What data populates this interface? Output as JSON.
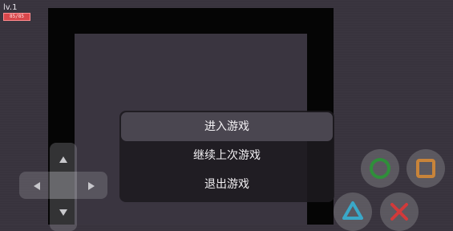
{
  "hud": {
    "level": "lv.1",
    "hp": "85/85"
  },
  "menu": {
    "items": [
      {
        "label": "进入游戏",
        "selected": true
      },
      {
        "label": "继续上次游戏",
        "selected": false
      },
      {
        "label": "退出游戏",
        "selected": false
      }
    ]
  },
  "controls": {
    "dpad_icons": [
      "arrow-up-icon",
      "arrow-left-icon",
      "arrow-right-icon",
      "arrow-down-icon"
    ],
    "action_buttons": [
      {
        "icon": "circle-icon",
        "color": "#2f8f3a"
      },
      {
        "icon": "square-icon",
        "color": "#c8843a"
      },
      {
        "icon": "triangle-icon",
        "color": "#3aa8c8"
      },
      {
        "icon": "cross-icon",
        "color": "#d23a3a"
      }
    ]
  },
  "colors": {
    "background": "#38333d",
    "maze_wall": "#050505",
    "menu_background": "#1c1a1f",
    "menu_selected": "#4a4650",
    "hp_bar": "#d8474b"
  }
}
